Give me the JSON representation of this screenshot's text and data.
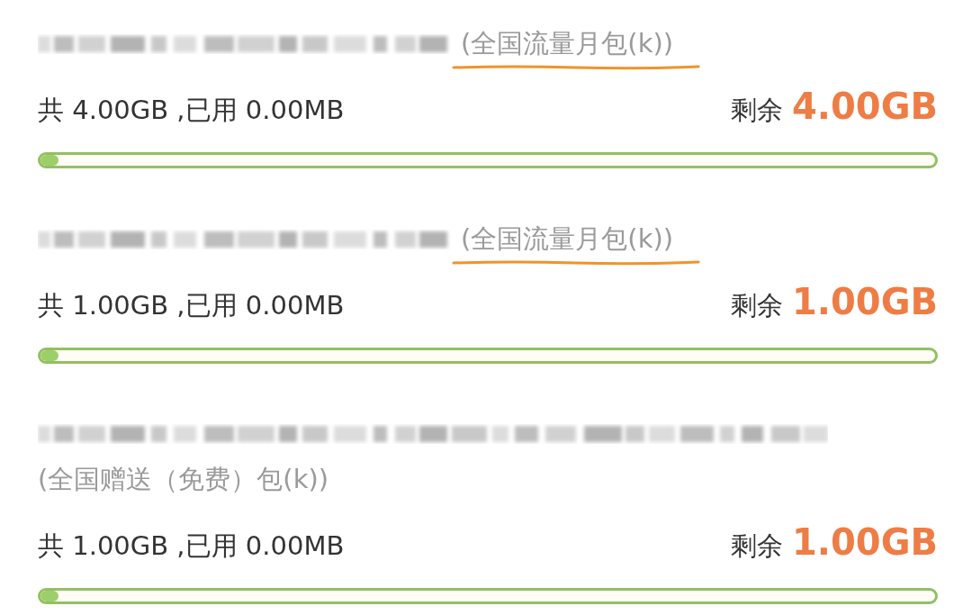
{
  "packages": [
    {
      "kind": "short",
      "name": "(全国流量月包(k))",
      "underlined": true,
      "usage": "共 4.00GB ,已用 0.00MB",
      "remaining_label": "剩余",
      "remaining": "4.00GB",
      "level": 0.02
    },
    {
      "kind": "short",
      "name": "(全国流量月包(k))",
      "underlined": true,
      "usage": "共 1.00GB ,已用 0.00MB",
      "remaining_label": "剩余",
      "remaining": "1.00GB",
      "level": 0.02
    },
    {
      "kind": "long",
      "name": "(全国赠送（免费）包(k))",
      "underlined": false,
      "usage": "共 1.00GB ,已用 0.00MB",
      "remaining_label": "剩余",
      "remaining": "1.00GB",
      "level": 0.02
    }
  ]
}
